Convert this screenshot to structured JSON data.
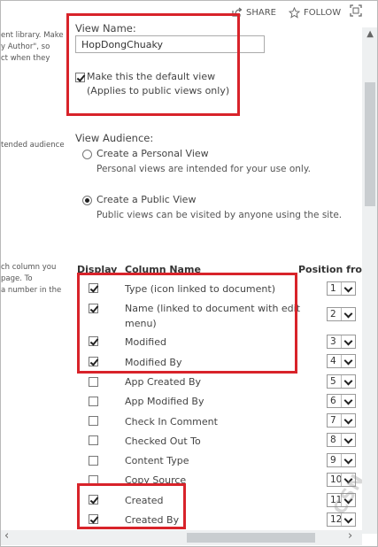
{
  "topbar": {
    "share": "SHARE",
    "follow": "FOLLOW"
  },
  "left_desc": [
    "ent library. Make",
    "y Author\", so",
    "ct when they",
    "tended audience",
    "ch column you",
    " page. To",
    " a number in the"
  ],
  "view_name": {
    "label": "View Name:",
    "value": "HopDongChuaky",
    "default_label": "Make this the default view",
    "default_note": "(Applies to public views only)",
    "default_checked": true
  },
  "audience": {
    "label": "View Audience:",
    "personal_label": "Create a Personal View",
    "personal_desc": "Personal views are intended for your use only.",
    "public_label": "Create a Public View",
    "public_desc": "Public views can be visited by anyone using the site.",
    "selected": "public"
  },
  "columns": {
    "header_display": "Display",
    "header_name": "Column Name",
    "header_position": "Position fron",
    "rows": [
      {
        "name": "Type (icon linked to document)",
        "checked": true,
        "position": "1"
      },
      {
        "name": "Name (linked to document with edit",
        "name2": "menu)",
        "checked": true,
        "position": "2"
      },
      {
        "name": "Modified",
        "checked": true,
        "position": "3"
      },
      {
        "name": "Modified By",
        "checked": true,
        "position": "4"
      },
      {
        "name": "App Created By",
        "checked": false,
        "position": "5"
      },
      {
        "name": "App Modified By",
        "checked": false,
        "position": "6"
      },
      {
        "name": "Check In Comment",
        "checked": false,
        "position": "7"
      },
      {
        "name": "Checked Out To",
        "checked": false,
        "position": "8"
      },
      {
        "name": "Content Type",
        "checked": false,
        "position": "9"
      },
      {
        "name": "Copy Source",
        "checked": false,
        "position": "10"
      },
      {
        "name": "Created",
        "checked": true,
        "position": "11"
      },
      {
        "name": "Created By",
        "checked": true,
        "position": "12"
      }
    ]
  },
  "watermark": "CSN",
  "colors": {
    "highlight": "#d8232a"
  }
}
